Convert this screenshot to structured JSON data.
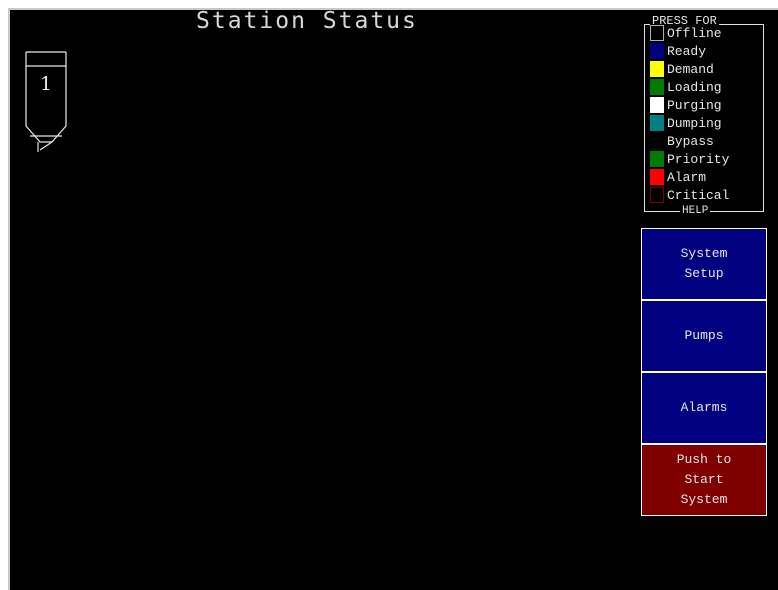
{
  "header": {
    "title": "Station Status"
  },
  "stations": [
    {
      "number": "1"
    }
  ],
  "legend": {
    "title": "PRESS FOR",
    "footer": "HELP",
    "items": [
      {
        "label": "Offline",
        "color": "#000000",
        "border": "#b0b0b0"
      },
      {
        "label": "Ready",
        "color": "#00007e",
        "border": "#00007e"
      },
      {
        "label": "Demand",
        "color": "#ffff00",
        "border": "#ffff00"
      },
      {
        "label": "Loading",
        "color": "#007b00",
        "border": "#007b00"
      },
      {
        "label": "Purging",
        "color": "#ffffff",
        "border": "#ffffff"
      },
      {
        "label": "Dumping",
        "color": "#008080",
        "border": "#008080"
      },
      {
        "label": "Bypass",
        "color": "#000000",
        "border": "#000000"
      },
      {
        "label": "Priority",
        "color": "#007b00",
        "border": "#007b00"
      },
      {
        "label": "Alarm",
        "color": "#ff0000",
        "border": "#ff0000"
      },
      {
        "label": "Critical",
        "color": "#000000",
        "border": "#7b0000"
      }
    ]
  },
  "buttons": {
    "system_setup": "System\nSetup",
    "pumps": "Pumps",
    "alarms": "Alarms",
    "start_system": "Push to\nStart\nSystem"
  },
  "colors": {
    "button_blue": "#000080",
    "button_red": "#800000",
    "background": "#000000"
  }
}
